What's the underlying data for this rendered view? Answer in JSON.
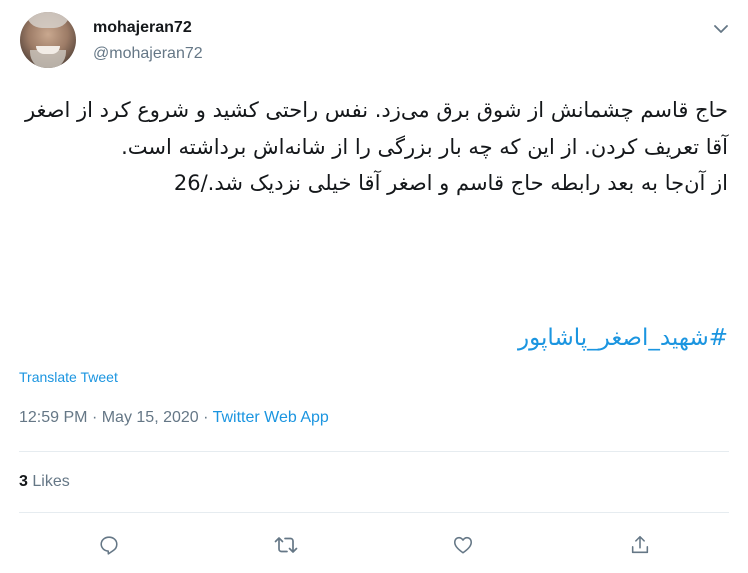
{
  "author": {
    "display_name": "mohajeran72",
    "handle": "@mohajeran72"
  },
  "tweet": {
    "text": "حاج قاسم چشمانش از شوق برق می‌زد. نفس راحتی کشید و شروع کرد از اصغر آقا تعریف کردن. از این که چه بار بزرگی را از شانه‌اش برداشته است.\nاز آن‌جا به بعد رابطه حاج قاسم و اصغر آقا خیلی نزدیک شد./26",
    "hashtag": "#شهید_اصغر_پاشاپور"
  },
  "translate_label": "Translate Tweet",
  "meta": {
    "time": "12:59 PM",
    "separator": "·",
    "date": "May 15, 2020",
    "source": "Twitter Web App"
  },
  "stats": {
    "likes_count": "3",
    "likes_label": "Likes"
  },
  "icons": {
    "menu": "chevron-down-icon",
    "reply": "reply-icon",
    "retweet": "retweet-icon",
    "like": "heart-icon",
    "share": "share-icon"
  },
  "colors": {
    "accent": "#1b95e0",
    "muted": "#657786",
    "text": "#14171a",
    "divider": "#e6ecf0"
  }
}
